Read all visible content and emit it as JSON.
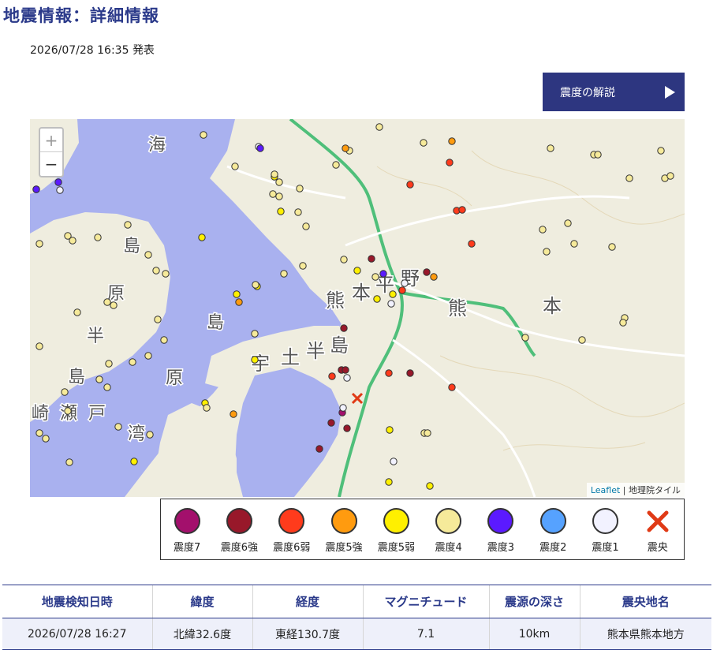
{
  "header": {
    "title": "地震情報：詳細情報",
    "published": "2026/07/28 16:35 発表"
  },
  "guide_button": {
    "label": "震度の解説"
  },
  "map": {
    "zoom_in": "+",
    "zoom_out": "−",
    "attribution_link": "Leaflet",
    "attribution_sep": " | ",
    "attribution_source": "地理院タイル",
    "labels": [
      "海",
      "島",
      "原",
      "半",
      "島",
      "崎",
      "瀬",
      "戸",
      "島",
      "原",
      "湾",
      "宇",
      "土",
      "半",
      "島",
      "熊",
      "本",
      "平",
      "野",
      "熊",
      "本"
    ],
    "colors": {
      "sea": "#a9b1ef",
      "land": "#efeddf",
      "road_major": "#4fbf7a",
      "road": "#ffffff"
    }
  },
  "legend": [
    {
      "label": "震度7",
      "color": "#a3106c",
      "icon": "circle"
    },
    {
      "label": "震度6強",
      "color": "#98182a",
      "icon": "circle"
    },
    {
      "label": "震度6弱",
      "color": "#ff3b1c",
      "icon": "circle"
    },
    {
      "label": "震度5強",
      "color": "#ff9b0f",
      "icon": "circle"
    },
    {
      "label": "震度5弱",
      "color": "#fff000",
      "icon": "circle"
    },
    {
      "label": "震度4",
      "color": "#f6ea9a",
      "icon": "circle"
    },
    {
      "label": "震度3",
      "color": "#5b1aff",
      "icon": "circle"
    },
    {
      "label": "震度2",
      "color": "#56a2ff",
      "icon": "circle"
    },
    {
      "label": "震度1",
      "color": "#f2f2ff",
      "icon": "circle"
    },
    {
      "label": "震央",
      "color": "#e03a16",
      "icon": "x-mark"
    }
  ],
  "table": {
    "headers": [
      "地震検知日時",
      "緯度",
      "経度",
      "マグニチュード",
      "震源の深さ",
      "震央地名"
    ],
    "row": [
      "2026/07/28 16:27",
      "北緯32.6度",
      "東経130.7度",
      "7.1",
      "10km",
      "熊本県熊本地方"
    ]
  }
}
